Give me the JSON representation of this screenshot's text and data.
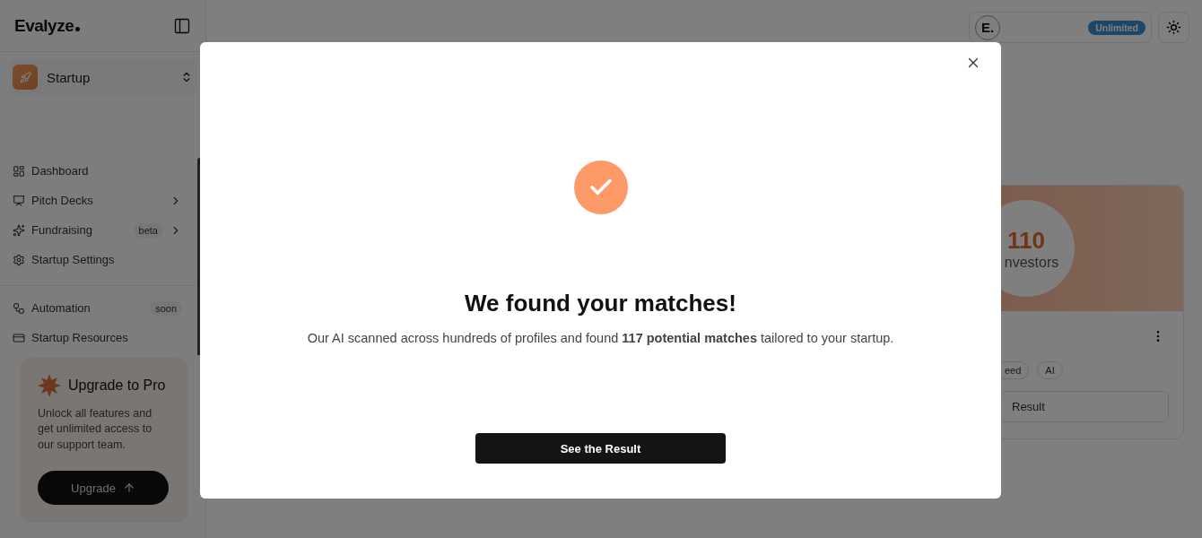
{
  "sidebar": {
    "logo": "Evalyze",
    "workspace": {
      "name": "Startup"
    },
    "nav_sections": [
      [
        {
          "label": "Dashboard",
          "has_submenu": false
        },
        {
          "label": "Pitch Decks",
          "has_submenu": true
        },
        {
          "label": "Fundraising",
          "badge": "beta",
          "has_submenu": true
        },
        {
          "label": "Startup Settings",
          "has_submenu": false
        }
      ],
      [
        {
          "label": "Automation",
          "badge": "soon",
          "has_submenu": false
        },
        {
          "label": "Startup Resources",
          "has_submenu": false
        }
      ]
    ],
    "upgrade": {
      "title": "Upgrade to Pro",
      "text": "Unlock all features and get unlimited access to our support team.",
      "button": "Upgrade"
    }
  },
  "header": {
    "account_logo": "E.",
    "plan_badge": "Unlimited"
  },
  "result_card": {
    "count": "110",
    "count_label": "nvestors",
    "tags": [
      "eed",
      "AI"
    ],
    "button": "Result"
  },
  "modal": {
    "title": "We found your matches!",
    "description": "Our AI scanned across hundreds of profiles and found **117 potential matches** tailored to your startup.",
    "button": "See the Result"
  }
}
